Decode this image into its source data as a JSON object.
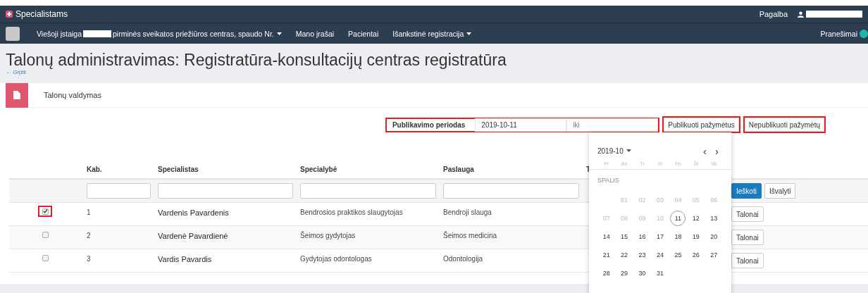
{
  "brand": {
    "label": "Specialistams"
  },
  "top_links": [
    {
      "label": "Pagalba",
      "kind": "link"
    },
    {
      "kind": "user"
    }
  ],
  "nav_items": [
    {
      "parts": [
        "Viešoji įstaiga",
        "pirminės sveikatos priežiūros centras, spaudo Nr."
      ],
      "dropdown": true
    },
    {
      "parts": [
        "Mano įrašai"
      ],
      "dropdown": false
    },
    {
      "parts": [
        "Pacientai"
      ],
      "dropdown": false
    },
    {
      "parts": [
        "Išankstinė registracija"
      ],
      "dropdown": true
    }
  ],
  "notifications": {
    "label": "Pranešimai"
  },
  "page_title": "Talonų administravimas: Registratūra-konsultacijų centras registratūra",
  "back_link": "← Grįžti",
  "panel": {
    "title": "Talonų valdymas"
  },
  "publish_filter": {
    "label": "Publikavimo periodas",
    "from_value": "2019-10-11",
    "to_placeholder": "iki",
    "highlighted": true
  },
  "publish_buttons": [
    {
      "label": "Publikuoti pažymėtus",
      "highlighted": true
    },
    {
      "label": "Nepublikuoti pažymėtų",
      "highlighted": true
    }
  ],
  "table": {
    "columns": [
      "Kab.",
      "Specialistas",
      "Specialybė",
      "Paslauga",
      "T"
    ],
    "filter_buttons": [
      {
        "label": "Ieškoti",
        "kind": "primary"
      },
      {
        "label": "Išvalyti",
        "kind": "default"
      }
    ],
    "rows": [
      {
        "checked": true,
        "highlighted": true,
        "cells": [
          "1",
          "Vardenis Pavardenis",
          "Bendrosios praktikos slaugytojas",
          "Bendroji slauga"
        ],
        "action": "Talonai"
      },
      {
        "checked": false,
        "highlighted": false,
        "cells": [
          "2",
          "Vardenė Pavardienė",
          "Šeimos gydytojas",
          "Šeimos medicina"
        ],
        "action": "Talonai"
      },
      {
        "checked": false,
        "highlighted": false,
        "cells": [
          "3",
          "Vardis Pavardis",
          "Gydytojas odontologas",
          "Odontologija"
        ],
        "action": "Talonai"
      }
    ]
  },
  "datepicker": {
    "month_label": "2019-10",
    "prev": "‹",
    "next": "›",
    "weekdays": [
      "Pr",
      "An",
      "Tr",
      "Kt",
      "Pn",
      "Št",
      "Sk"
    ],
    "month_name": "SPALIS",
    "weeks": [
      [
        {
          "label": "01",
          "disabled": true,
          "today": false
        },
        {
          "label": "02",
          "disabled": true,
          "today": false
        },
        {
          "label": "03",
          "disabled": true,
          "today": false
        },
        {
          "label": "04",
          "disabled": true,
          "today": false
        },
        {
          "label": "05",
          "disabled": true,
          "today": false
        },
        {
          "label": "06",
          "disabled": true,
          "today": false
        }
      ],
      [
        {
          "label": "07",
          "disabled": true,
          "today": false
        },
        {
          "label": "08",
          "disabled": true,
          "today": false
        },
        {
          "label": "09",
          "disabled": true,
          "today": false
        },
        {
          "label": "10",
          "disabled": true,
          "today": false
        },
        {
          "label": "11",
          "disabled": false,
          "today": true
        },
        {
          "label": "12",
          "disabled": false,
          "today": false
        },
        {
          "label": "13",
          "disabled": false,
          "today": false
        }
      ],
      [
        {
          "label": "14",
          "disabled": false,
          "today": false
        },
        {
          "label": "15",
          "disabled": false,
          "today": false
        },
        {
          "label": "16",
          "disabled": false,
          "today": false
        },
        {
          "label": "17",
          "disabled": false,
          "today": false
        },
        {
          "label": "18",
          "disabled": false,
          "today": false
        },
        {
          "label": "19",
          "disabled": false,
          "today": false
        },
        {
          "label": "20",
          "disabled": false,
          "today": false
        }
      ],
      [
        {
          "label": "21",
          "disabled": false,
          "today": false
        },
        {
          "label": "22",
          "disabled": false,
          "today": false
        },
        {
          "label": "23",
          "disabled": false,
          "today": false
        },
        {
          "label": "24",
          "disabled": false,
          "today": false
        },
        {
          "label": "25",
          "disabled": false,
          "today": false
        },
        {
          "label": "26",
          "disabled": false,
          "today": false
        },
        {
          "label": "27",
          "disabled": false,
          "today": false
        }
      ],
      [
        {
          "label": "28",
          "disabled": false,
          "today": false
        },
        {
          "label": "29",
          "disabled": false,
          "today": false
        },
        {
          "label": "30",
          "disabled": false,
          "today": false
        },
        {
          "label": "31",
          "disabled": false,
          "today": false
        }
      ]
    ]
  }
}
